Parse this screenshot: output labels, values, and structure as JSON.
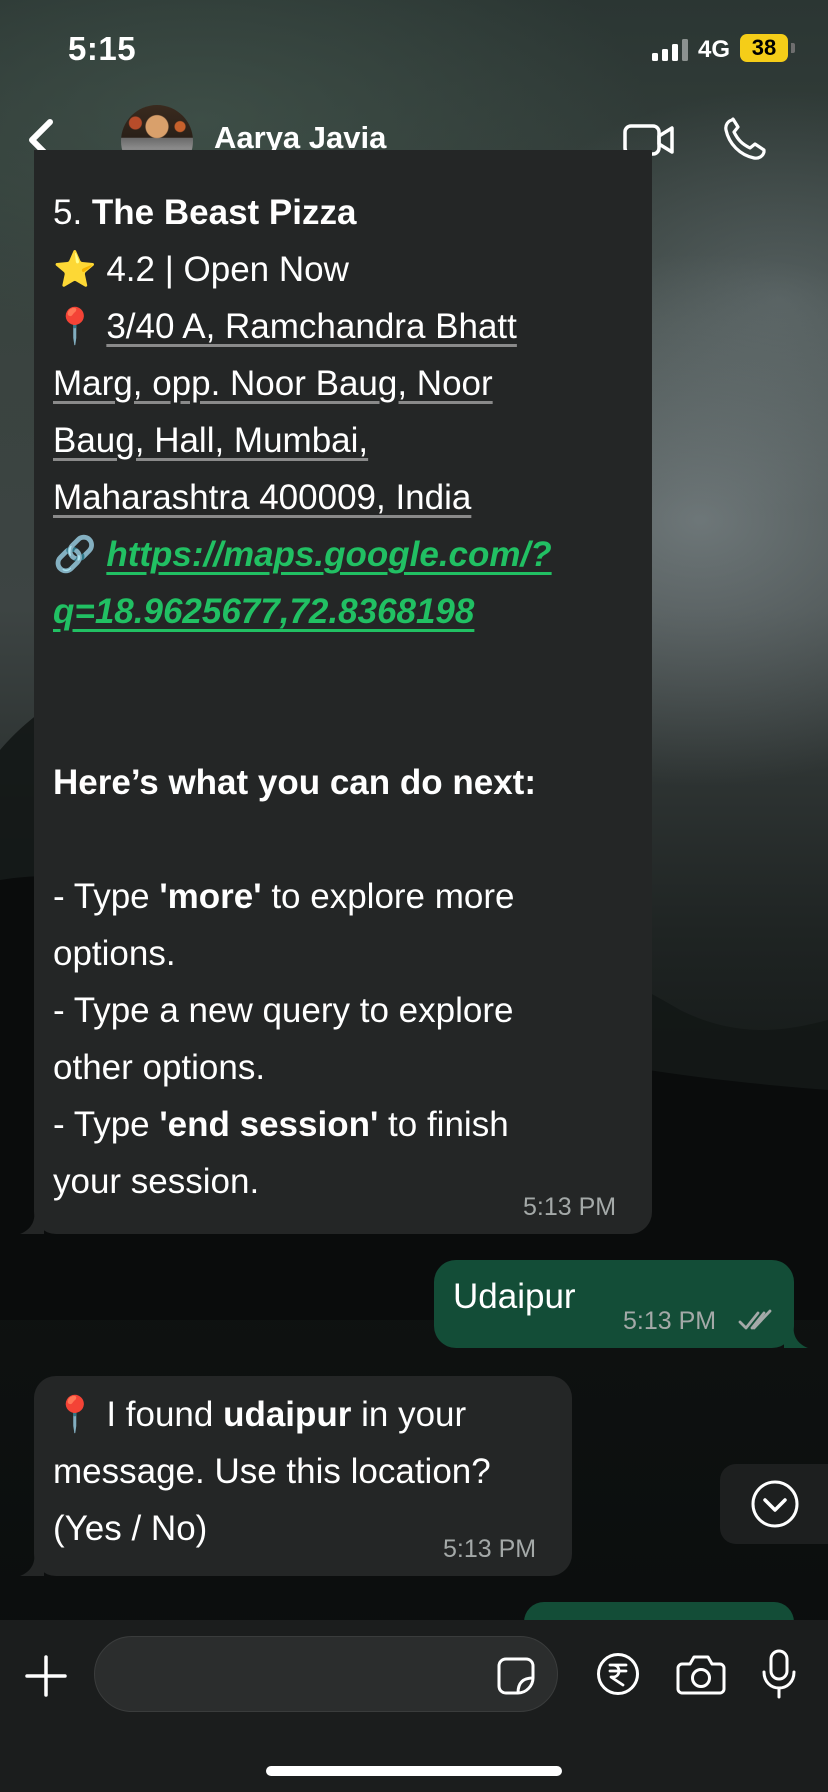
{
  "status_bar": {
    "time": "5:15",
    "network": "4G",
    "battery": "38",
    "battery_color": "#f5cd18"
  },
  "header": {
    "contact_name": "Aarya Javia",
    "back_icon": "chevron-left-icon",
    "video_icon": "video-camera-icon",
    "call_icon": "phone-icon"
  },
  "messages": {
    "m1": {
      "num": "5. ",
      "title": "The Beast Pizza",
      "star": "⭐",
      "rating": " 4.2 | Open Now",
      "pin": "📍",
      "address_lines": [
        "3/40 A, Ramchandra Bhatt",
        "Marg, opp. Noor Baug, Noor",
        "Baug, Hall, Mumbai,",
        "Maharashtra 400009, India"
      ],
      "link_emoji": "🔗",
      "link_lines": [
        "https://maps.google.com/?",
        "q=18.9625677,72.8368198"
      ],
      "next_heading": "Here’s what you can do next:",
      "opt1_pre": " - Type ",
      "opt1_bold": "'more'",
      "opt1_post": " to explore more",
      "opt1_line2": "options.",
      "opt2_line1": " - Type a new query to explore",
      "opt2_line2": "other options.",
      "opt3_pre": " - Type ",
      "opt3_bold": "'end session'",
      "opt3_post": " to finish",
      "opt3_line2": "your session.",
      "time": "5:13 PM"
    },
    "m2": {
      "text": "Udaipur",
      "time": "5:13 PM",
      "read_icon": "double-check-icon",
      "bubble_color": "#134d37"
    },
    "m3": {
      "pin": "📍",
      "pre": " I found ",
      "bold": "udaipur",
      "post": " in your",
      "line2": "message. Use this location?",
      "line3": "(Yes / No)",
      "time": "5:13 PM"
    }
  },
  "scroll_button_icon": "chevron-down-circle-icon",
  "input_bar": {
    "placeholder": "",
    "plus_icon": "plus-icon",
    "sticker_icon": "sticker-icon",
    "payment_icon": "rupee-icon",
    "camera_icon": "camera-icon",
    "mic_icon": "microphone-icon"
  },
  "colors": {
    "accent_link": "#21c063",
    "incoming_bubble": "#242626",
    "outgoing_bubble": "#134d37"
  }
}
